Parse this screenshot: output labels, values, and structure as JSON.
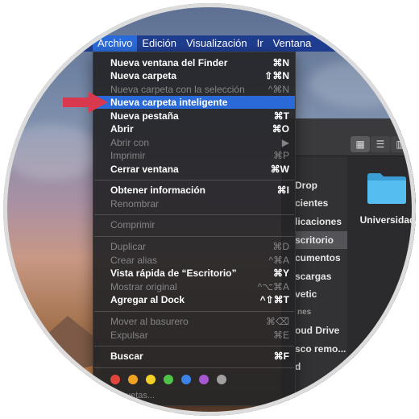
{
  "menubar": {
    "items": [
      "Archivo",
      "Edición",
      "Visualización",
      "Ir",
      "Ventana"
    ]
  },
  "menu": {
    "items": [
      {
        "label": "Nueva ventana del Finder",
        "shortcut": "⌘N",
        "enabled": true
      },
      {
        "label": "Nueva carpeta",
        "shortcut": "⇧⌘N",
        "enabled": true
      },
      {
        "label": "Nueva carpeta con la selección",
        "shortcut": "^⌘N",
        "enabled": false
      },
      {
        "label": "Nueva carpeta inteligente",
        "shortcut": "",
        "enabled": true,
        "highlighted": true
      },
      {
        "label": "Nueva pestaña",
        "shortcut": "⌘T",
        "enabled": true
      },
      {
        "label": "Abrir",
        "shortcut": "⌘O",
        "enabled": true
      },
      {
        "label": "Abrir con",
        "shortcut": "▶",
        "enabled": false
      },
      {
        "label": "Imprimir",
        "shortcut": "⌘P",
        "enabled": false
      },
      {
        "label": "Cerrar ventana",
        "shortcut": "⌘W",
        "enabled": true
      },
      {
        "label": "Obtener información",
        "shortcut": "⌘I",
        "enabled": true
      },
      {
        "label": "Renombrar",
        "shortcut": "",
        "enabled": false
      },
      {
        "label": "Comprimir",
        "shortcut": "",
        "enabled": false
      },
      {
        "label": "Duplicar",
        "shortcut": "⌘D",
        "enabled": false
      },
      {
        "label": "Crear alias",
        "shortcut": "^⌘A",
        "enabled": false
      },
      {
        "label": "Vista rápida de “Escritorio”",
        "shortcut": "⌘Y",
        "enabled": true
      },
      {
        "label": "Mostrar original",
        "shortcut": "^⌥⌘A",
        "enabled": false
      },
      {
        "label": "Agregar al Dock",
        "shortcut": "^⇧⌘T",
        "enabled": true
      },
      {
        "label": "Mover al basurero",
        "shortcut": "⌘⌫",
        "enabled": false
      },
      {
        "label": "Expulsar",
        "shortcut": "⌘E",
        "enabled": false
      },
      {
        "label": "Buscar",
        "shortcut": "⌘F",
        "enabled": true
      }
    ],
    "tags_label": "Etiquetas...",
    "tag_colors": [
      "#e0463c",
      "#f0a323",
      "#f2d027",
      "#4fc34a",
      "#3b83e6",
      "#a857d1",
      "#a0a0a0"
    ]
  },
  "finder": {
    "sidebar": [
      "Drop",
      "cientes",
      "licaciones",
      "scritorio",
      "cumentos",
      "scargas",
      "vetic",
      "nes",
      "oud Drive",
      "sco remo...",
      "d"
    ],
    "selected": "scritorio",
    "folder": {
      "label": "Universidad",
      "color": "#49b4e8"
    }
  },
  "colors": {
    "highlight": "#2a6ad8",
    "menubar": "#1f3d8f",
    "arrow": "#d9394f"
  },
  "icons": {
    "pointer": "red-arrow-icon",
    "folder": "folder-icon",
    "view_icons": "grid-view-icon",
    "view_list": "list-view-icon",
    "view_columns": "column-view-icon"
  }
}
